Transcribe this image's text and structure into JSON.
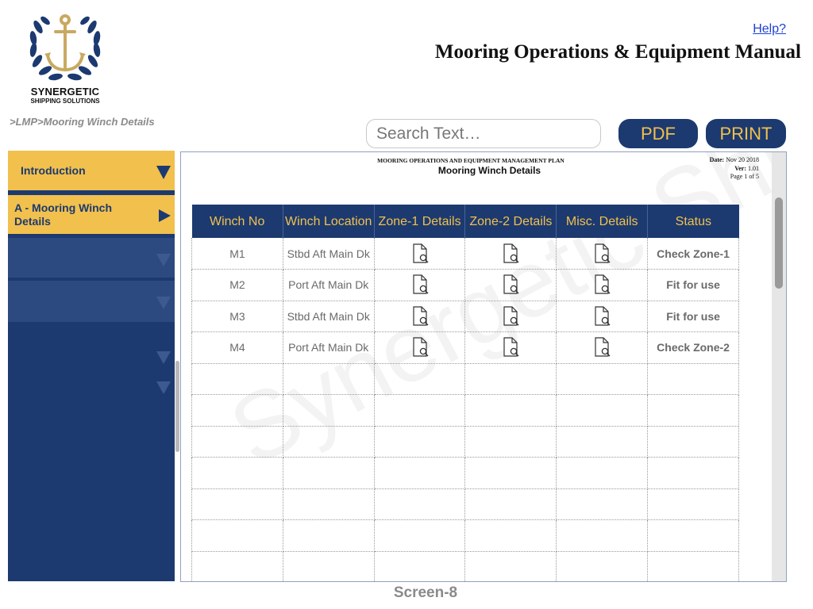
{
  "brand": {
    "name_line1": "SYNERGETIC",
    "name_line2": "SHIPPING SOLUTIONS",
    "logo_icon": "anchor-laurel-icon"
  },
  "header": {
    "help_label": "Help?",
    "title": "Mooring Operations & Equipment Manual"
  },
  "breadcrumb": ">LMP>Mooring Winch Details",
  "search": {
    "placeholder": "Search Text…"
  },
  "toolbar": {
    "pdf_label": "PDF",
    "print_label": "PRINT"
  },
  "sidebar": {
    "items": [
      {
        "label": "Introduction",
        "indicator": "triangle-down-icon"
      },
      {
        "label": "A - Mooring Winch Details",
        "indicator": "triangle-right-icon"
      }
    ]
  },
  "document": {
    "header_caps": "MOORING OPERATIONS AND EQUIPMENT MANAGEMENT PLAN",
    "title": "Mooring Winch Details",
    "date_label": "Date:",
    "date_value": "Nov 20 2018",
    "ver_label": "Ver:",
    "ver_value": "1.01",
    "page_text": "Page 1 of 5",
    "watermark": "Synergetic Shipping"
  },
  "table": {
    "columns": [
      "Winch No",
      "Winch Location",
      "Zone-1 Details",
      "Zone-2 Details",
      "Misc. Details",
      "Status"
    ],
    "rows": [
      {
        "winch_no": "M1",
        "location": "Stbd Aft Main Dk",
        "status": "Check Zone-1",
        "status_type": "warning"
      },
      {
        "winch_no": "M2",
        "location": "Port Aft Main Dk",
        "status": "Fit for use",
        "status_type": "ok"
      },
      {
        "winch_no": "M3",
        "location": "Stbd Aft Main Dk",
        "status": "Fit for use",
        "status_type": "ok"
      },
      {
        "winch_no": "M4",
        "location": "Port Aft Main Dk",
        "status": "Check Zone-2",
        "status_type": "warning"
      }
    ],
    "details_icon": "document-search-icon",
    "status_colors": {
      "warning": "#d9301e",
      "ok": "#4caf24"
    }
  },
  "footer": {
    "screen_label": "Screen-8"
  },
  "colors": {
    "navy": "#1c3a70",
    "gold": "#f2c04c"
  }
}
